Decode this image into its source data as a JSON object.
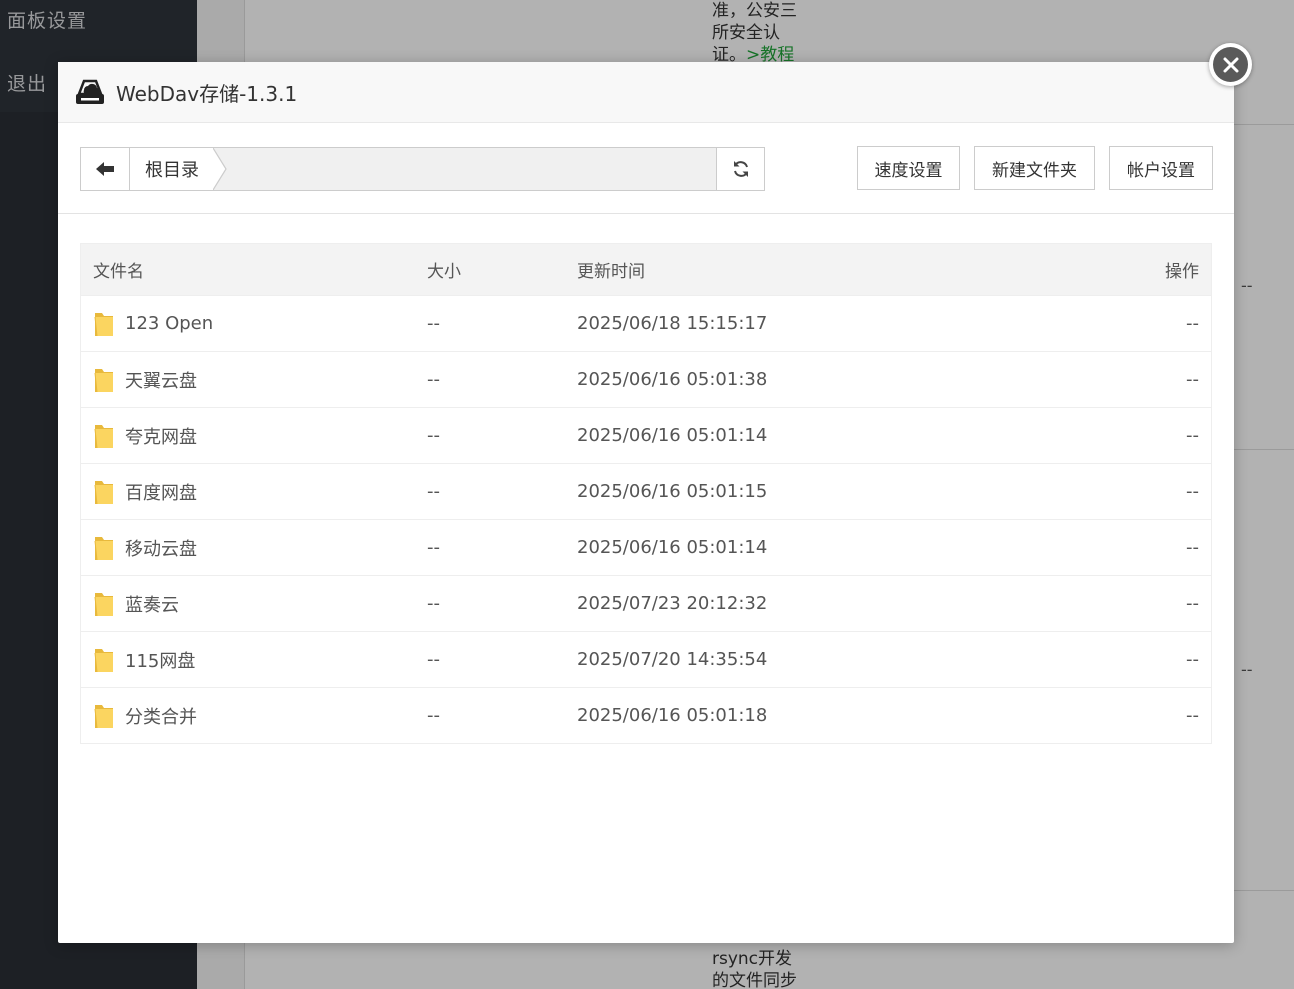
{
  "background": {
    "sidebar_items": [
      "面板设置",
      "退出"
    ],
    "text_top": [
      "准，公安三",
      "所安全认"
    ],
    "text_top_partial": "证。",
    "text_top_link": ">教程",
    "text_bottom": [
      "rsync开发",
      "的文件同步"
    ],
    "dash": "--"
  },
  "modal": {
    "logo_icon": "webdav-drive-icon",
    "title": "WebDav存储-1.3.1",
    "close_icon": "close-icon",
    "path_bar": {
      "back_icon": "arrow-left-icon",
      "root_label": "根目录",
      "refresh_icon": "refresh-icon"
    },
    "buttons": {
      "speed": "速度设置",
      "new_folder": "新建文件夹",
      "account": "帐户设置"
    },
    "table": {
      "headers": {
        "name": "文件名",
        "size": "大小",
        "time": "更新时间",
        "op": "操作"
      },
      "rows": [
        {
          "name": "123 Open",
          "size": "--",
          "time": "2025/06/18 15:15:17",
          "op": "--"
        },
        {
          "name": "天翼云盘",
          "size": "--",
          "time": "2025/06/16 05:01:38",
          "op": "--"
        },
        {
          "name": "夸克网盘",
          "size": "--",
          "time": "2025/06/16 05:01:14",
          "op": "--"
        },
        {
          "name": "百度网盘",
          "size": "--",
          "time": "2025/06/16 05:01:15",
          "op": "--"
        },
        {
          "name": "移动云盘",
          "size": "--",
          "time": "2025/06/16 05:01:14",
          "op": "--"
        },
        {
          "name": "蓝奏云",
          "size": "--",
          "time": "2025/07/23 20:12:32",
          "op": "--"
        },
        {
          "name": "115网盘",
          "size": "--",
          "time": "2025/07/20 14:35:54",
          "op": "--"
        },
        {
          "name": "分类合并",
          "size": "--",
          "time": "2025/06/16 05:01:18",
          "op": "--"
        }
      ]
    }
  }
}
